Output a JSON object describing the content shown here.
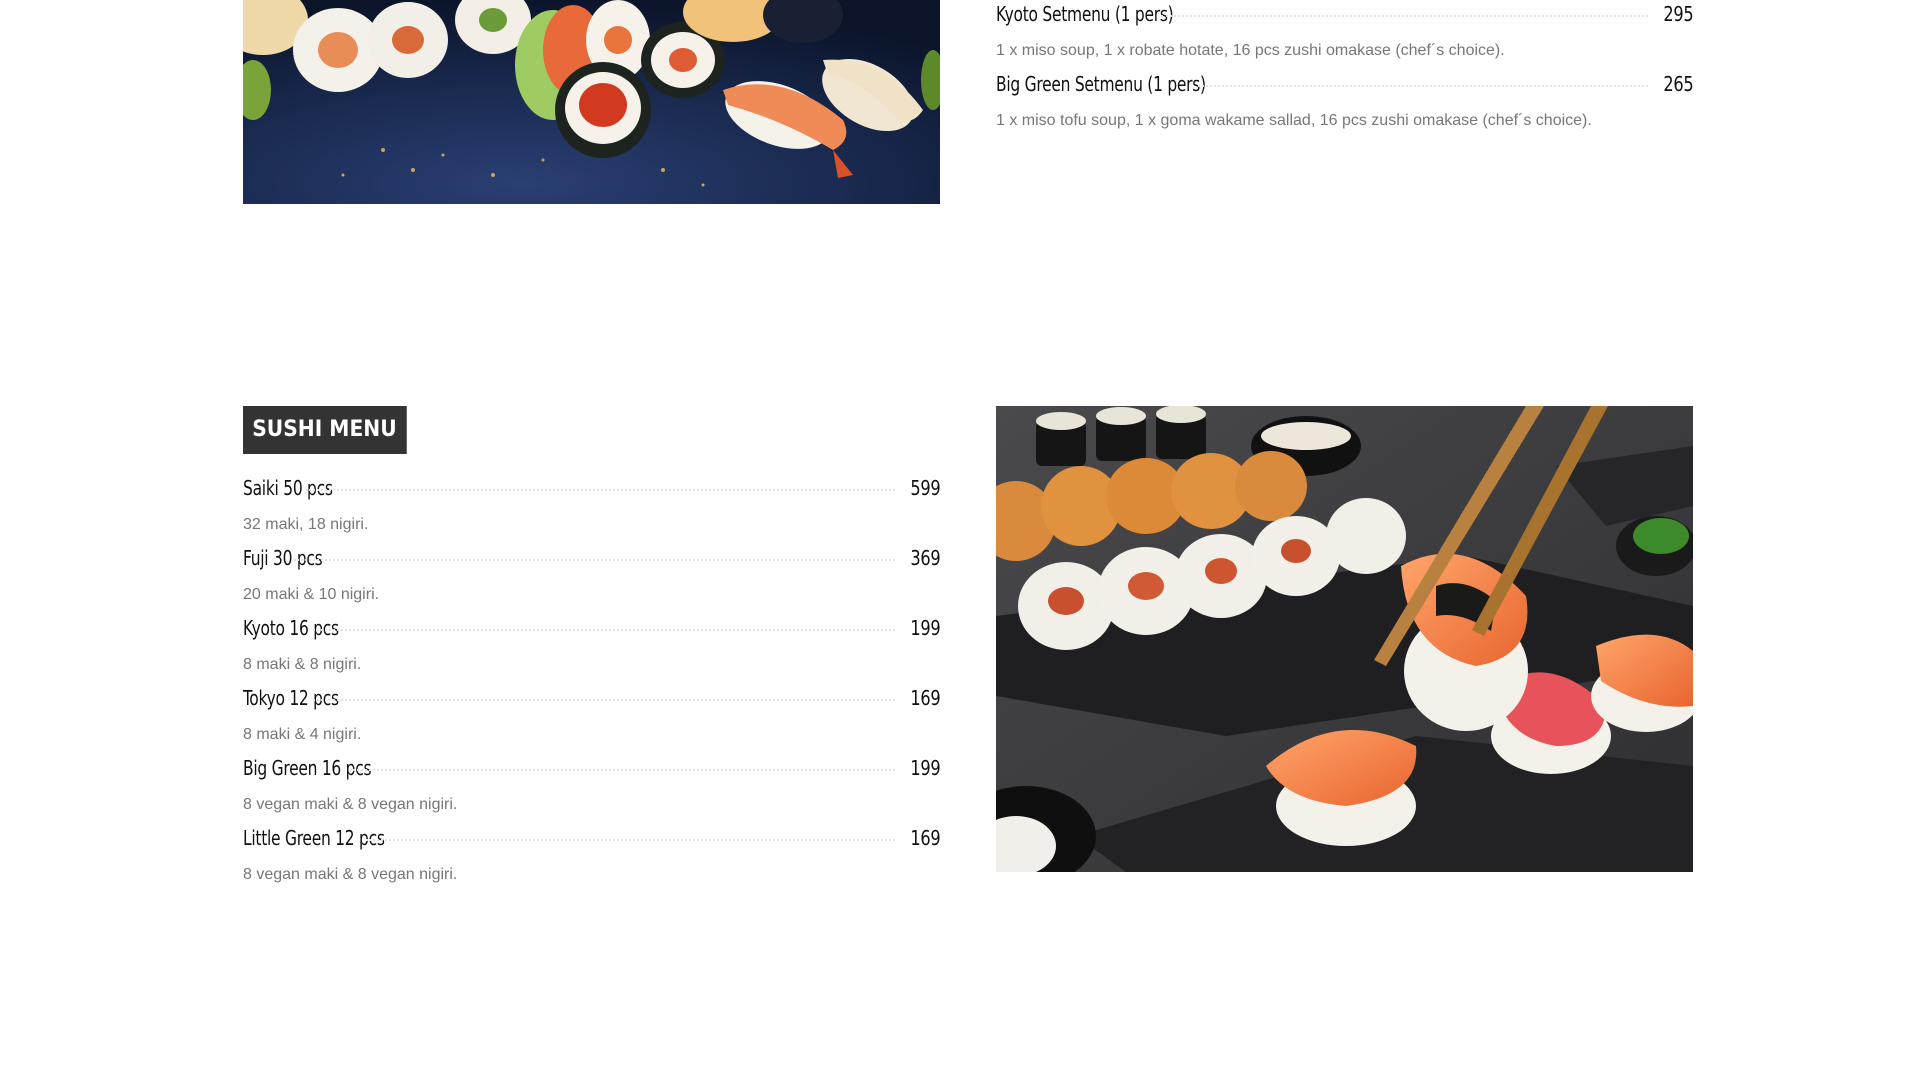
{
  "top_menu": {
    "items": [
      {
        "name": "Kyoto Setmenu (1 pers)",
        "price": "295",
        "desc": "1 x miso soup, 1 x robate hotate, 16 pcs zushi omakase (chef´s choice)."
      },
      {
        "name": "Big Green Setmenu (1 pers)",
        "price": "265",
        "desc": "1 x miso tofu soup, 1 x goma wakame sallad, 16 pcs zushi omakase (chef´s choice)."
      }
    ]
  },
  "sushi_menu": {
    "title": "SUSHI MENU",
    "items": [
      {
        "name": "Saiki 50 pcs",
        "price": "599",
        "desc": "32 maki, 18 nigiri."
      },
      {
        "name": "Fuji 30 pcs",
        "price": "369",
        "desc": "20 maki & 10 nigiri."
      },
      {
        "name": "Kyoto 16 pcs",
        "price": "199",
        "desc": "8 maki & 8 nigiri."
      },
      {
        "name": "Tokyo 12 pcs",
        "price": "169",
        "desc": "8 maki & 4 nigiri."
      },
      {
        "name": "Big Green 16 pcs",
        "price": "199",
        "desc": "8 vegan maki & 8 vegan nigiri."
      },
      {
        "name": "Little Green 12 pcs",
        "price": "169",
        "desc": "8 vegan maki & 8 vegan nigiri."
      }
    ]
  },
  "colors": {
    "badge_bg": "#333333",
    "badge_text": "#ffffff",
    "item_text": "#111111",
    "desc_text": "#777777",
    "leader_dots": "#e3e3e3"
  },
  "images": {
    "top_photo": "sushi-platter-photo",
    "bottom_photo": "nigiri-chopsticks-photo"
  }
}
